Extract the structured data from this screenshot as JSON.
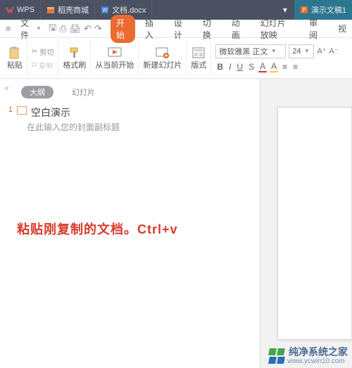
{
  "titlebar": {
    "appname": "WPS",
    "tabs": [
      {
        "label": "稻壳商城",
        "icon": "store-icon",
        "active": false
      },
      {
        "label": "文档.docx",
        "icon": "word-icon",
        "active": false
      },
      {
        "label": "演示文稿1",
        "icon": "ppt-icon",
        "active": true
      }
    ]
  },
  "menubar": {
    "file": "文件",
    "tabs": [
      "开始",
      "插入",
      "设计",
      "切换",
      "动画",
      "幻灯片放映",
      "审阅",
      "视"
    ]
  },
  "ribbon": {
    "paste": "粘贴",
    "cut": "剪切",
    "copy": "复制",
    "format_painter": "格式刷",
    "from_beginning": "从当前开始",
    "new_slide": "新建幻灯片",
    "layout": "版式",
    "font_name": "微软雅黑 正文",
    "font_size": "24"
  },
  "outline": {
    "tab_outline": "大纲",
    "tab_slides": "幻灯片",
    "slide_number": "1",
    "slide_title": "空白演示",
    "slide_subtitle": "在此输入您的封面副标题"
  },
  "annotation": "粘贴刚复制的文档。Ctrl+v",
  "watermark": {
    "name": "纯净系统之家",
    "url": "www.ycwin10.com"
  }
}
